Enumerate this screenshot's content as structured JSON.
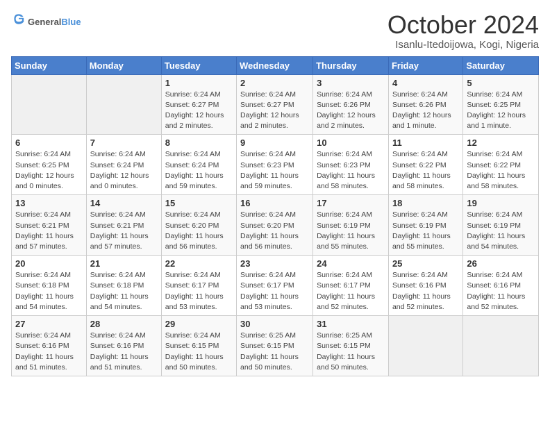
{
  "header": {
    "logo_general": "General",
    "logo_blue": "Blue",
    "title": "October 2024",
    "location": "Isanlu-Itedoijowa, Kogi, Nigeria"
  },
  "days_of_week": [
    "Sunday",
    "Monday",
    "Tuesday",
    "Wednesday",
    "Thursday",
    "Friday",
    "Saturday"
  ],
  "weeks": [
    [
      {
        "day": "",
        "detail": ""
      },
      {
        "day": "",
        "detail": ""
      },
      {
        "day": "1",
        "detail": "Sunrise: 6:24 AM\nSunset: 6:27 PM\nDaylight: 12 hours and 2 minutes."
      },
      {
        "day": "2",
        "detail": "Sunrise: 6:24 AM\nSunset: 6:27 PM\nDaylight: 12 hours and 2 minutes."
      },
      {
        "day": "3",
        "detail": "Sunrise: 6:24 AM\nSunset: 6:26 PM\nDaylight: 12 hours and 2 minutes."
      },
      {
        "day": "4",
        "detail": "Sunrise: 6:24 AM\nSunset: 6:26 PM\nDaylight: 12 hours and 1 minute."
      },
      {
        "day": "5",
        "detail": "Sunrise: 6:24 AM\nSunset: 6:25 PM\nDaylight: 12 hours and 1 minute."
      }
    ],
    [
      {
        "day": "6",
        "detail": "Sunrise: 6:24 AM\nSunset: 6:25 PM\nDaylight: 12 hours and 0 minutes."
      },
      {
        "day": "7",
        "detail": "Sunrise: 6:24 AM\nSunset: 6:24 PM\nDaylight: 12 hours and 0 minutes."
      },
      {
        "day": "8",
        "detail": "Sunrise: 6:24 AM\nSunset: 6:24 PM\nDaylight: 11 hours and 59 minutes."
      },
      {
        "day": "9",
        "detail": "Sunrise: 6:24 AM\nSunset: 6:23 PM\nDaylight: 11 hours and 59 minutes."
      },
      {
        "day": "10",
        "detail": "Sunrise: 6:24 AM\nSunset: 6:23 PM\nDaylight: 11 hours and 58 minutes."
      },
      {
        "day": "11",
        "detail": "Sunrise: 6:24 AM\nSunset: 6:22 PM\nDaylight: 11 hours and 58 minutes."
      },
      {
        "day": "12",
        "detail": "Sunrise: 6:24 AM\nSunset: 6:22 PM\nDaylight: 11 hours and 58 minutes."
      }
    ],
    [
      {
        "day": "13",
        "detail": "Sunrise: 6:24 AM\nSunset: 6:21 PM\nDaylight: 11 hours and 57 minutes."
      },
      {
        "day": "14",
        "detail": "Sunrise: 6:24 AM\nSunset: 6:21 PM\nDaylight: 11 hours and 57 minutes."
      },
      {
        "day": "15",
        "detail": "Sunrise: 6:24 AM\nSunset: 6:20 PM\nDaylight: 11 hours and 56 minutes."
      },
      {
        "day": "16",
        "detail": "Sunrise: 6:24 AM\nSunset: 6:20 PM\nDaylight: 11 hours and 56 minutes."
      },
      {
        "day": "17",
        "detail": "Sunrise: 6:24 AM\nSunset: 6:19 PM\nDaylight: 11 hours and 55 minutes."
      },
      {
        "day": "18",
        "detail": "Sunrise: 6:24 AM\nSunset: 6:19 PM\nDaylight: 11 hours and 55 minutes."
      },
      {
        "day": "19",
        "detail": "Sunrise: 6:24 AM\nSunset: 6:19 PM\nDaylight: 11 hours and 54 minutes."
      }
    ],
    [
      {
        "day": "20",
        "detail": "Sunrise: 6:24 AM\nSunset: 6:18 PM\nDaylight: 11 hours and 54 minutes."
      },
      {
        "day": "21",
        "detail": "Sunrise: 6:24 AM\nSunset: 6:18 PM\nDaylight: 11 hours and 54 minutes."
      },
      {
        "day": "22",
        "detail": "Sunrise: 6:24 AM\nSunset: 6:17 PM\nDaylight: 11 hours and 53 minutes."
      },
      {
        "day": "23",
        "detail": "Sunrise: 6:24 AM\nSunset: 6:17 PM\nDaylight: 11 hours and 53 minutes."
      },
      {
        "day": "24",
        "detail": "Sunrise: 6:24 AM\nSunset: 6:17 PM\nDaylight: 11 hours and 52 minutes."
      },
      {
        "day": "25",
        "detail": "Sunrise: 6:24 AM\nSunset: 6:16 PM\nDaylight: 11 hours and 52 minutes."
      },
      {
        "day": "26",
        "detail": "Sunrise: 6:24 AM\nSunset: 6:16 PM\nDaylight: 11 hours and 52 minutes."
      }
    ],
    [
      {
        "day": "27",
        "detail": "Sunrise: 6:24 AM\nSunset: 6:16 PM\nDaylight: 11 hours and 51 minutes."
      },
      {
        "day": "28",
        "detail": "Sunrise: 6:24 AM\nSunset: 6:16 PM\nDaylight: 11 hours and 51 minutes."
      },
      {
        "day": "29",
        "detail": "Sunrise: 6:24 AM\nSunset: 6:15 PM\nDaylight: 11 hours and 50 minutes."
      },
      {
        "day": "30",
        "detail": "Sunrise: 6:25 AM\nSunset: 6:15 PM\nDaylight: 11 hours and 50 minutes."
      },
      {
        "day": "31",
        "detail": "Sunrise: 6:25 AM\nSunset: 6:15 PM\nDaylight: 11 hours and 50 minutes."
      },
      {
        "day": "",
        "detail": ""
      },
      {
        "day": "",
        "detail": ""
      }
    ]
  ]
}
